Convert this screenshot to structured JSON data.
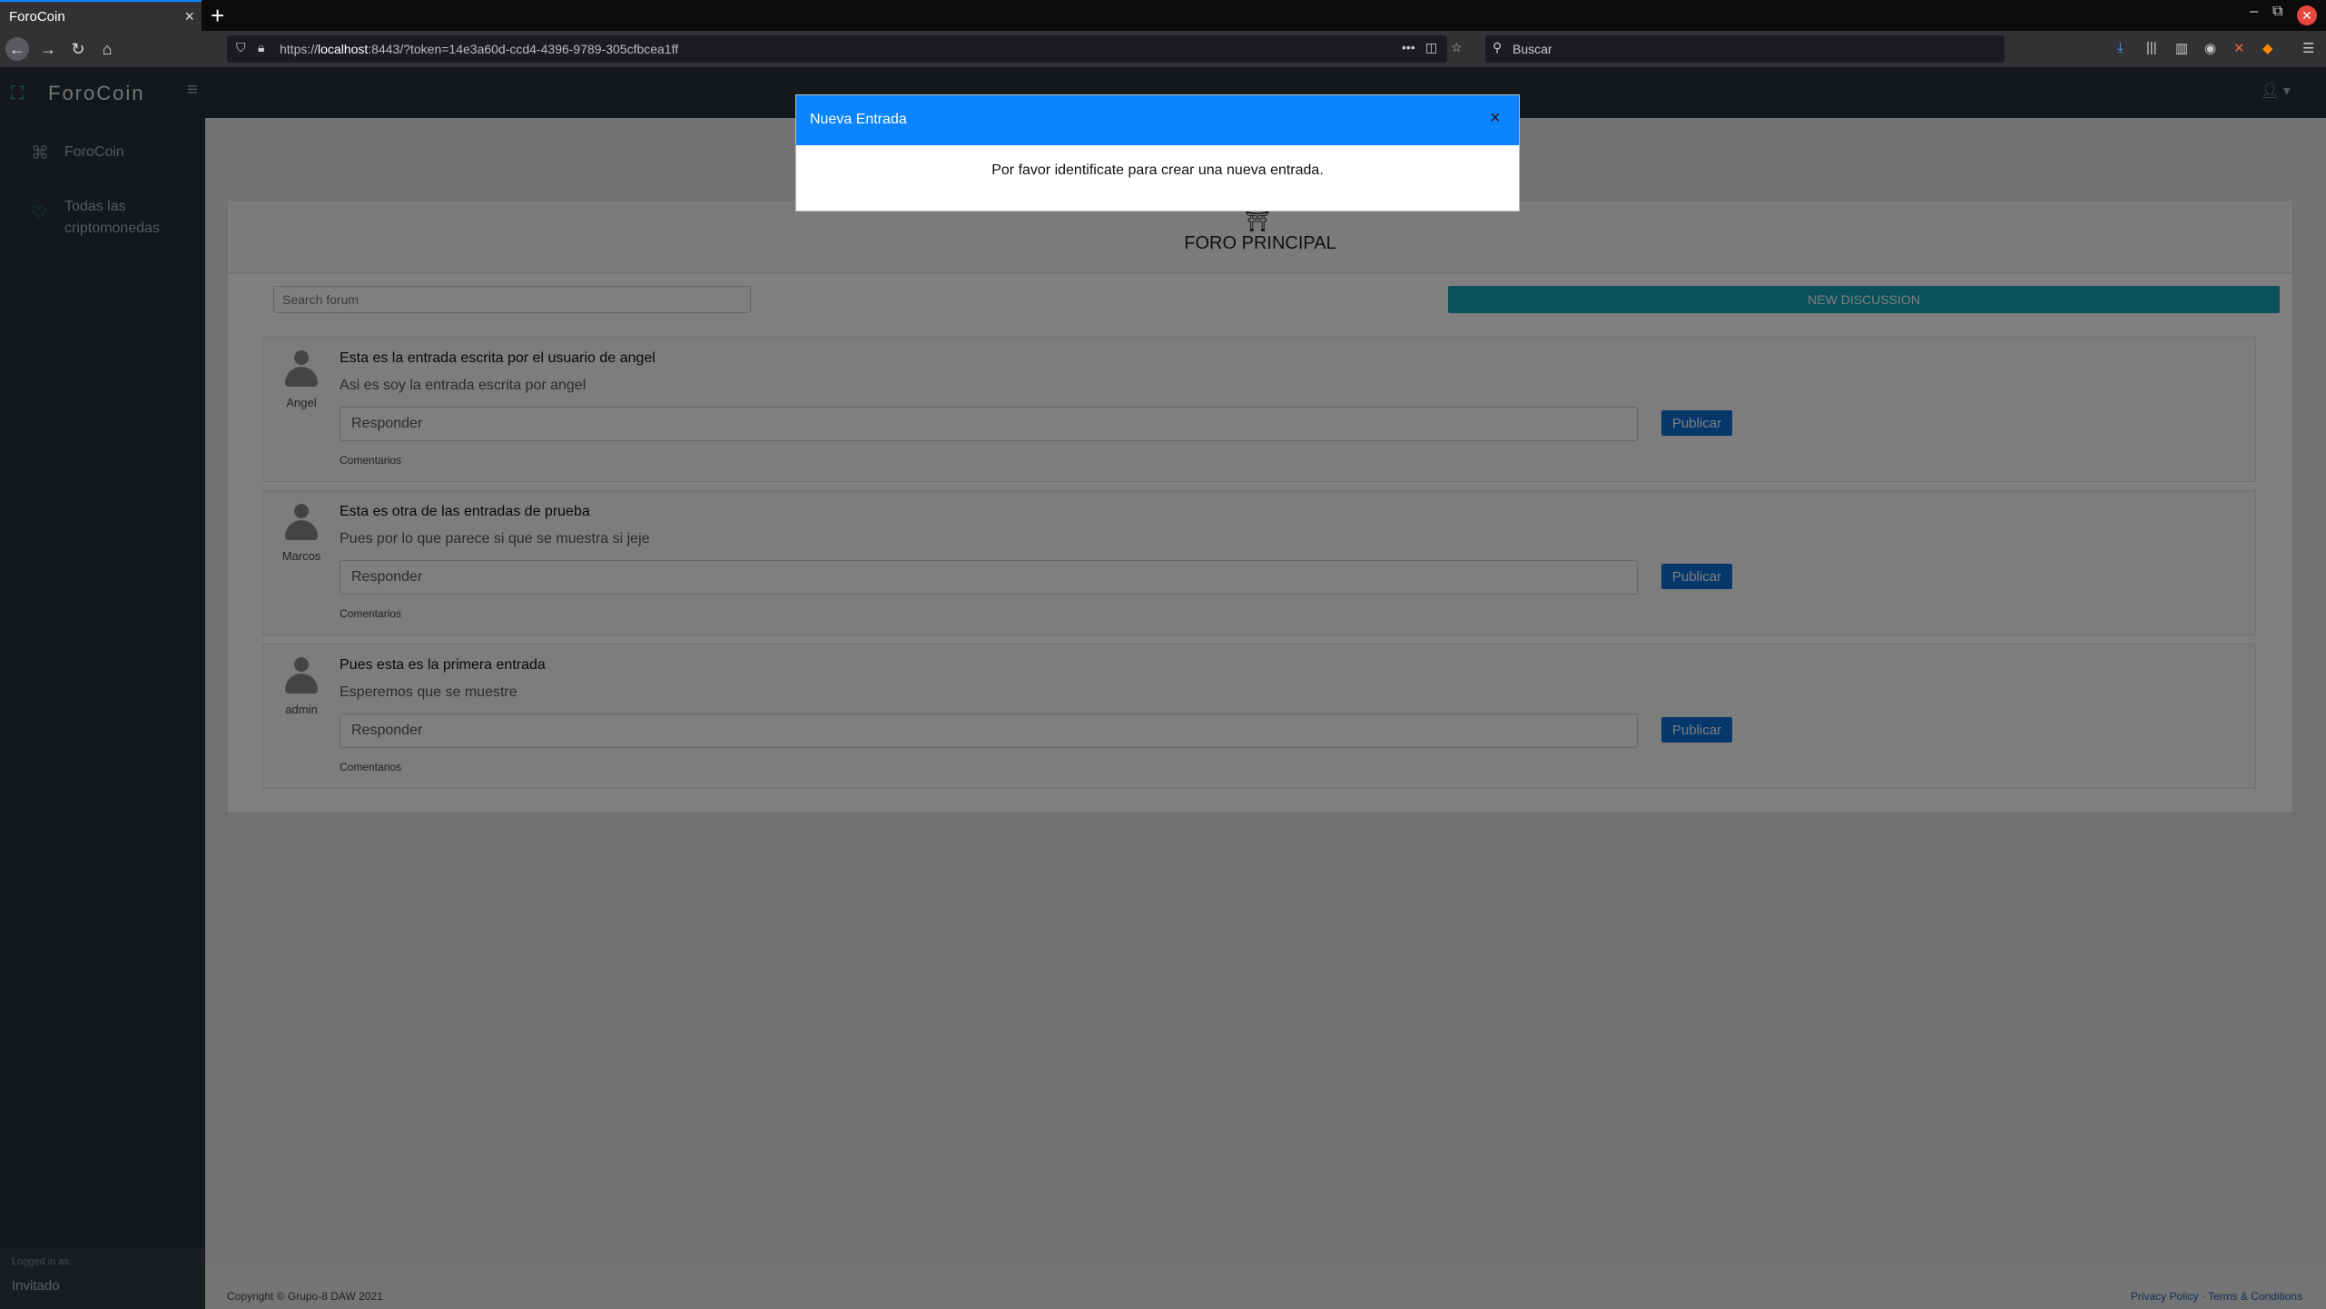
{
  "browser": {
    "tab_title": "ForoCoin",
    "tab_close": "×",
    "new_tab": "+",
    "url_prefix": "https://",
    "url_host": "localhost",
    "url_rest": ":8443/?token=14e3a60d-ccd4-4396-9789-305cfbcea1ff",
    "search_placeholder": "Buscar",
    "url_more": "•••"
  },
  "app": {
    "brand": "ForoCoin",
    "sidebar": {
      "items": [
        {
          "label": "ForoCoin",
          "icon": "network-icon"
        },
        {
          "label": "Todas las criptomonedas",
          "icon": "heart-icon"
        }
      ],
      "logged_label": "Logged in as:",
      "logged_user": "Invitado"
    },
    "forum": {
      "title": "FORO PRINCIPAL",
      "search_placeholder": "Search forum",
      "new_discussion": "NEW DISCUSSION",
      "reply_placeholder": "Responder",
      "publish_label": "Publicar",
      "comments_label": "Comentarios",
      "posts": [
        {
          "author": "Angel",
          "title": "Esta es la entrada escrita por el usuario de angel",
          "body": "Asi es soy la entrada escrita por angel"
        },
        {
          "author": "Marcos",
          "title": "Esta es otra de las entradas de prueba",
          "body": "Pues por lo que parece si que se muestra si jeje"
        },
        {
          "author": "admin",
          "title": "Pues esta es la primera entrada",
          "body": "Esperemos que se muestre"
        }
      ]
    },
    "footer": {
      "copyright": "Copyright © Grupo-8 DAW 2021",
      "privacy": "Privacy Policy",
      "separator": " · ",
      "terms": "Terms & Conditions"
    }
  },
  "modal": {
    "title": "Nueva Entrada",
    "close": "×",
    "message": "Por favor identificate para crear una nueva entrada."
  },
  "colors": {
    "accent": "#0a84ff",
    "teal_button": "#17a2b8",
    "publish_button": "#0a6fd6"
  }
}
